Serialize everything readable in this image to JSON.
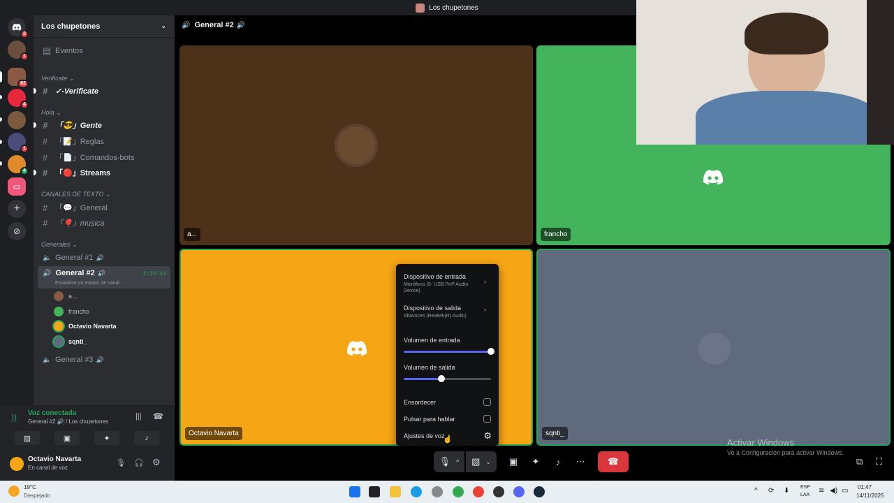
{
  "titlebar": {
    "title": "Los chupetones"
  },
  "rail": {
    "servers": [
      {
        "badge": "2"
      },
      {
        "badge": "1"
      },
      {
        "badge": "62"
      },
      {
        "badge": "4"
      },
      {
        "badge": ""
      },
      {
        "badge": "1"
      },
      {
        "badge": "4"
      },
      {
        "badge": ""
      }
    ]
  },
  "sidebar": {
    "guild_name": "Los chupetones",
    "events_label": "Eventos",
    "categories": {
      "verificate": "Verificate",
      "hola": "Hola",
      "texto": "CANALES DE TEXTO",
      "generales": "Generales"
    },
    "channels": {
      "verificate": "✓-Verificate",
      "gente": "「😎」Gente",
      "reglas": "「📝」Reglas",
      "comandos": "「📄」Comandos-bots",
      "streams": "「🔴」Streams",
      "general": "「💬」General",
      "musica": "「🎈」musica",
      "general1": "General #1",
      "general2": "General #2",
      "general3": "General #3"
    },
    "voice_timer": "2:25:43",
    "voice_status": "Establece un estado de canal",
    "voice_users": [
      "a...",
      "francho",
      "Octavio Navarta",
      "sqnti_"
    ]
  },
  "voice_panel": {
    "status": "Voz conectada",
    "location": "General #2 🔊 / Los chupetones"
  },
  "user_panel": {
    "name": "Octavio Navarta",
    "status": "En canal de voz"
  },
  "stage": {
    "header_title": "General #2",
    "tiles": [
      {
        "name": "a...",
        "color": "#4e3119"
      },
      {
        "name": "francho",
        "color": "#43b45c"
      },
      {
        "name": "Octavio Navarta",
        "color": "#f6a515"
      },
      {
        "name": "sqnti_",
        "color": "#5f6a7c"
      }
    ]
  },
  "popup": {
    "input_device": "Dispositivo de entrada",
    "input_device_sub": "Micrófono (5- USB PnP Audio Device)",
    "output_device": "Dispositivo de salida",
    "output_device_sub": "Altavoces (Realtek(R) Audio)",
    "input_volume": "Volumen de entrada",
    "input_volume_level": 1.0,
    "output_volume": "Volumen de salida",
    "output_volume_level": 0.43,
    "deafen": "Ensordecer",
    "push_to_talk": "Pulsar para hablar",
    "voice_settings": "Ajustes de voz"
  },
  "watermark": {
    "title": "Activar Windows",
    "sub": "Ve a Configuración para activar Windows."
  },
  "taskbar": {
    "weather_temp": "19°C",
    "weather_desc": "Despejado",
    "lang_top": "ESP",
    "lang_bottom": "LAA",
    "time": "01:47",
    "date": "14/11/2025"
  },
  "colors": {
    "green": "#23a55a",
    "blurple": "#5865f2",
    "red": "#da373c"
  }
}
